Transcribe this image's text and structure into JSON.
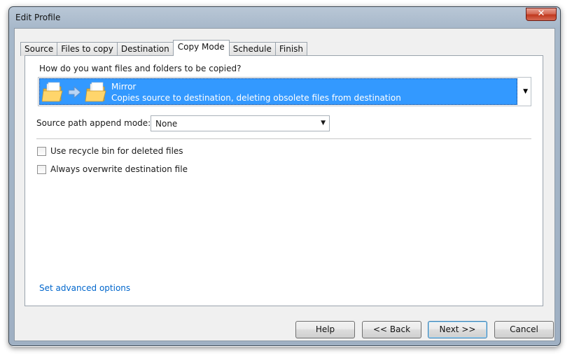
{
  "window": {
    "title": "Edit Profile",
    "close_label": "✕"
  },
  "tabs": [
    {
      "label": "Source"
    },
    {
      "label": "Files to copy"
    },
    {
      "label": "Destination"
    },
    {
      "label": "Copy Mode"
    },
    {
      "label": "Schedule"
    },
    {
      "label": "Finish"
    }
  ],
  "active_tab": "Copy Mode",
  "copy_mode": {
    "question": "How do you want files and folders to be copied?",
    "selected": {
      "name": "Mirror",
      "description": "Copies source to destination, deleting obsolete files from destination",
      "icon": "folder-to-folder-icon"
    }
  },
  "append_mode": {
    "label": "Source path append mode:",
    "value": "None"
  },
  "options": [
    {
      "label": "Use recycle bin for deleted files",
      "checked": false
    },
    {
      "label": "Always overwrite destination file",
      "checked": false
    }
  ],
  "advanced_link": "Set advanced options",
  "buttons": {
    "help": "Help",
    "back": "<< Back",
    "next": "Next >>",
    "cancel": "Cancel"
  },
  "colors": {
    "selection": "#3399ff",
    "link": "#0066cc",
    "frame": "#a7b8ca"
  }
}
